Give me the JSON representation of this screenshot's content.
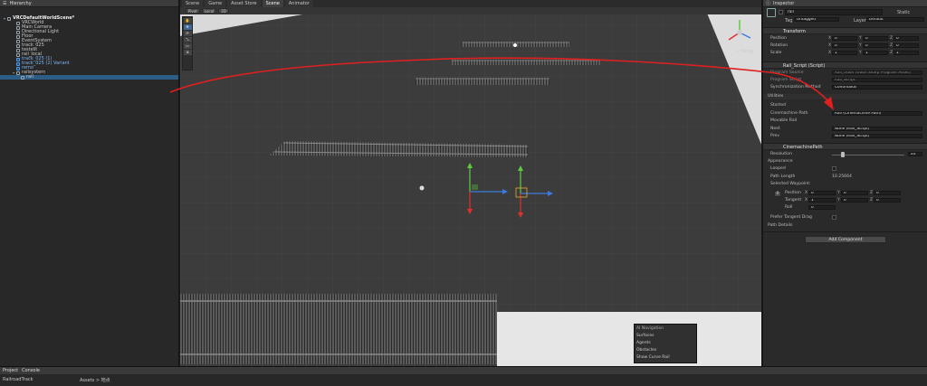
{
  "hierarchy": {
    "tab": "Hierarchy",
    "items": [
      {
        "label": "VRCDefaultWorldScene*",
        "depth": 0,
        "bold": true
      },
      {
        "label": "VRCWorld",
        "depth": 2
      },
      {
        "label": "Main Camera",
        "depth": 2
      },
      {
        "label": "Directional Light",
        "depth": 2
      },
      {
        "label": "Floor",
        "depth": 2
      },
      {
        "label": "EventSystem",
        "depth": 2
      },
      {
        "label": "track_025",
        "depth": 2
      },
      {
        "label": "testest",
        "depth": 2
      },
      {
        "label": "rail_local",
        "depth": 2
      },
      {
        "label": "track_025 (1)",
        "depth": 2,
        "prefab": true
      },
      {
        "label": "track_025 (2) Variant",
        "depth": 2,
        "prefab": true
      },
      {
        "label": "remo",
        "depth": 2,
        "prefab": true
      },
      {
        "label": "railsystem",
        "depth": 2
      },
      {
        "label": "rail",
        "depth": 3,
        "selected": true
      }
    ]
  },
  "scene": {
    "tabs": [
      "Scene",
      "Game",
      "Asset Store",
      "Scene",
      "Animator"
    ],
    "toolbar": [
      "Pivot",
      "Local",
      "2D"
    ],
    "tools": [
      "✋",
      "✥",
      "⟳",
      "⤡",
      "▭",
      "⊕"
    ],
    "gizmo_persp": "< Persp",
    "overlay": {
      "title": "AI Navigation",
      "items": [
        "Surfaces",
        "Agents",
        "Obstacles",
        "Show Curve Rail"
      ]
    }
  },
  "inspector": {
    "tab": "Inspector",
    "object_name": "rail",
    "static_label": "Static",
    "tag_label": "Tag",
    "tag_value": "Untagged",
    "layer_label": "Layer",
    "layer_value": "Default",
    "transform": {
      "title": "Transform",
      "rows": [
        {
          "label": "Position",
          "x": "0",
          "y": "0",
          "z": "0"
        },
        {
          "label": "Rotation",
          "x": "0",
          "y": "0",
          "z": "0"
        },
        {
          "label": "Scale",
          "x": "1",
          "y": "1",
          "z": "1"
        }
      ]
    },
    "rail_script": {
      "title": "Rail_Script (Script)",
      "rows": [
        {
          "label": "Program Source",
          "value": "Rail_Udon (Udon Sharp Program Asset)"
        },
        {
          "label": "Program Script",
          "value": "Rail_Script"
        },
        {
          "label": "Synchronization Method",
          "value": "Continuous"
        }
      ],
      "utilities": "Utilities",
      "started": "Started",
      "cinemachine_path_label": "Cinemachine Path",
      "cinemachine_path_value": "Rail (Cinemachine Path)",
      "movable_rail": "Movable Rail",
      "next_label": "Next",
      "next_value": "None (Rail_Script)",
      "prev_label": "Prev",
      "prev_value": "None (Rail_Script)"
    },
    "cinemachine": {
      "title": "CinemachinePath",
      "resolution_label": "Resolution",
      "resolution_value": "20",
      "resolution_fraction": 0.15,
      "appearance": "Appearance",
      "looped": "Looped",
      "path_length_label": "Path Length",
      "path_length_value": "10.25664",
      "selected_waypoint": "Selected Waypoint:",
      "waypoint_index": "0",
      "position_label": "Position",
      "position": {
        "x": "0",
        "y": "0",
        "z": "0"
      },
      "tangent_label": "Tangent",
      "tangent": {
        "x": "1",
        "y": "0",
        "z": "0"
      },
      "roll_label": "Roll",
      "roll_value": "0",
      "prefer_tangent": "Prefer Tangent Drag",
      "path_details": "Path Details"
    },
    "add_component": "Add Component"
  },
  "bottom": {
    "tabs": [
      "Project",
      "Console"
    ],
    "folder": "RailroadTrack",
    "path": "Assets > 地点"
  },
  "colors": {
    "annotation": "#e02020",
    "selection": "#2c5d87"
  }
}
